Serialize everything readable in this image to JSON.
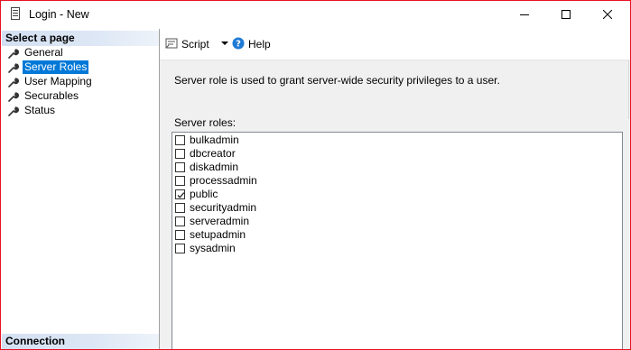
{
  "window": {
    "title": "Login - New",
    "accent_border": "#e81123"
  },
  "left_pane": {
    "select_header": "Select a page",
    "connection_header": "Connection",
    "items": [
      {
        "label": "General",
        "icon": "wrench-icon",
        "active": false
      },
      {
        "label": "Server Roles",
        "icon": "wrench-icon",
        "active": true
      },
      {
        "label": "User Mapping",
        "icon": "wrench-icon",
        "active": false
      },
      {
        "label": "Securables",
        "icon": "wrench-icon",
        "active": false
      },
      {
        "label": "Status",
        "icon": "wrench-icon",
        "active": false
      }
    ]
  },
  "toolbar": {
    "script_label": "Script",
    "help_label": "Help"
  },
  "main": {
    "description": "Server role is used to grant server-wide security privileges to a user.",
    "roles_label": "Server roles:",
    "roles": [
      {
        "name": "bulkadmin",
        "checked": false
      },
      {
        "name": "dbcreator",
        "checked": false
      },
      {
        "name": "diskadmin",
        "checked": false
      },
      {
        "name": "processadmin",
        "checked": false
      },
      {
        "name": "public",
        "checked": true
      },
      {
        "name": "securityadmin",
        "checked": false
      },
      {
        "name": "serveradmin",
        "checked": false
      },
      {
        "name": "setupadmin",
        "checked": false
      },
      {
        "name": "sysadmin",
        "checked": false
      }
    ]
  },
  "colors": {
    "selection": "#0078d7",
    "header_gradient": "#d3e0f2",
    "pane_background": "#f0f0f0",
    "help_icon": "#1e7bd6"
  }
}
